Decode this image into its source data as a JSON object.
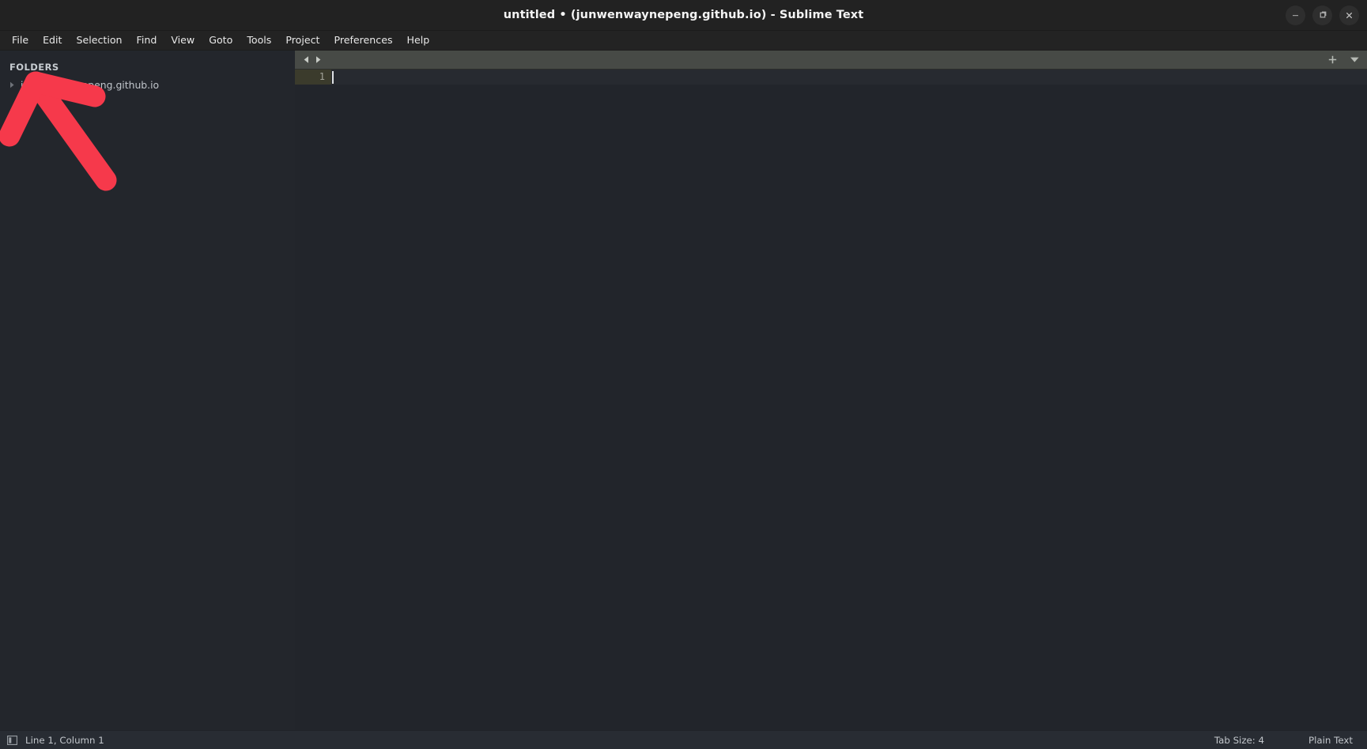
{
  "window": {
    "title": "untitled • (junwenwaynepeng.github.io) - Sublime Text",
    "controls": {
      "minimize": "minimize-button",
      "maximize": "maximize-button",
      "close": "close-button"
    }
  },
  "menubar": {
    "items": [
      {
        "label": "File"
      },
      {
        "label": "Edit"
      },
      {
        "label": "Selection"
      },
      {
        "label": "Find"
      },
      {
        "label": "View"
      },
      {
        "label": "Goto"
      },
      {
        "label": "Tools"
      },
      {
        "label": "Project"
      },
      {
        "label": "Preferences"
      },
      {
        "label": "Help"
      }
    ]
  },
  "sidebar": {
    "header": "FOLDERS",
    "folders": [
      {
        "name": "junwenwaynepeng.github.io",
        "expanded": false
      }
    ]
  },
  "tabbar": {
    "prev_icon": "chevron-left-icon",
    "next_icon": "chevron-right-icon",
    "new_tab_icon": "plus-icon",
    "tab_list_icon": "chevron-down-icon",
    "tabs": []
  },
  "editor": {
    "line_numbers": [
      "1"
    ],
    "lines": [
      ""
    ],
    "cursor_line": 1,
    "cursor_column": 1
  },
  "statusbar": {
    "sidebar_toggle_icon": "sidebar-toggle-icon",
    "position": "Line 1, Column 1",
    "tab_size": "Tab Size: 4",
    "syntax": "Plain Text"
  },
  "annotation": {
    "type": "arrow",
    "color": "#F6394B",
    "points_to": "FOLDERS sidebar header"
  },
  "colors": {
    "titlebar_bg": "#222222",
    "menubar_bg": "#232323",
    "sidebar_bg": "#23262c",
    "editor_bg": "#22252b",
    "tabbar_bg": "#474a46",
    "statusbar_bg": "#282c33",
    "accent_red": "#F6394B",
    "current_line_gutter": "#3b3b2c"
  }
}
